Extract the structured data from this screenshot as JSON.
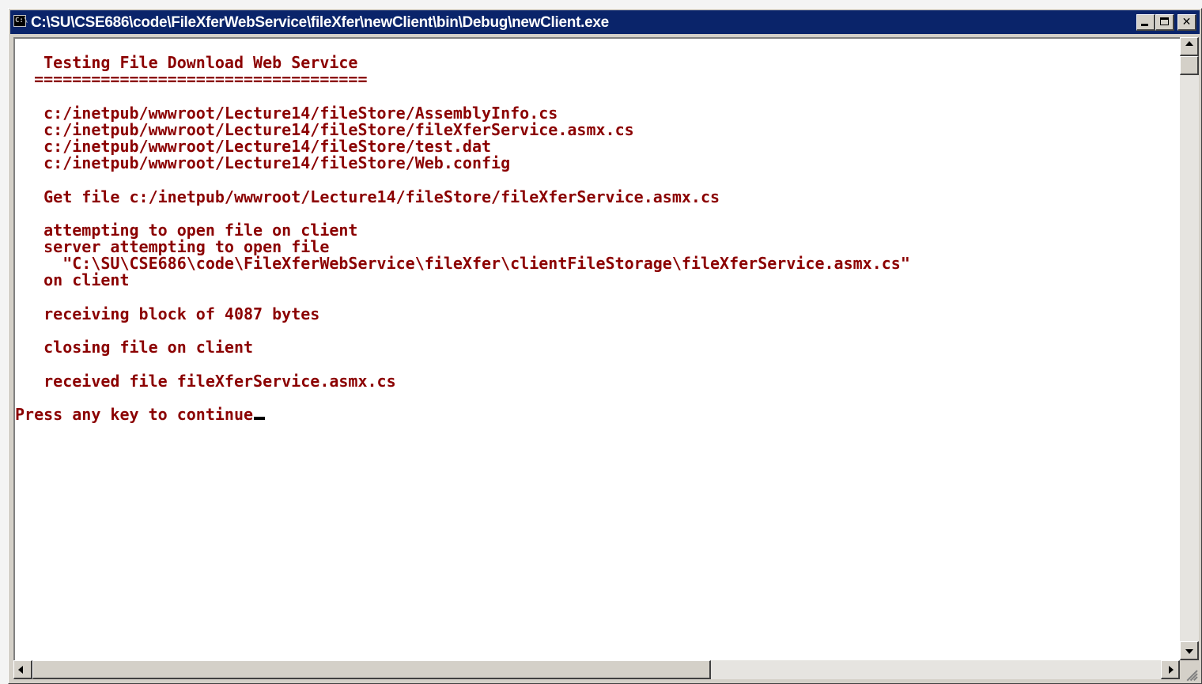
{
  "window": {
    "title": "C:\\SU\\CSE686\\code\\FileXferWebService\\fileXfer\\newClient\\bin\\Debug\\newClient.exe",
    "icon": "console-app-icon",
    "icon_glyph": "C:\\",
    "buttons": {
      "minimize": "minimize-icon",
      "maximize": "maximize-icon",
      "close": "close-icon",
      "close_glyph": "✕"
    }
  },
  "console": {
    "text_color": "#8b0000",
    "background": "#ffffff",
    "lines": [
      "   Testing File Download Web Service",
      "  ===================================",
      "",
      "   c:/inetpub/wwwroot/Lecture14/fileStore/AssemblyInfo.cs",
      "   c:/inetpub/wwwroot/Lecture14/fileStore/fileXferService.asmx.cs",
      "   c:/inetpub/wwwroot/Lecture14/fileStore/test.dat",
      "   c:/inetpub/wwwroot/Lecture14/fileStore/Web.config",
      "",
      "   Get file c:/inetpub/wwwroot/Lecture14/fileStore/fileXferService.asmx.cs",
      "",
      "   attempting to open file on client",
      "   server attempting to open file",
      "     \"C:\\SU\\CSE686\\code\\FileXferWebService\\fileXfer\\clientFileStorage\\fileXferService.asmx.cs\"",
      "   on client",
      "",
      "   receiving block of 4087 bytes",
      "",
      "   closing file on client",
      "",
      "   received file fileXferService.asmx.cs",
      "",
      "Press any key to continue"
    ]
  },
  "scrollbars": {
    "vertical_position": 0.0,
    "horizontal_position": 0.0
  }
}
